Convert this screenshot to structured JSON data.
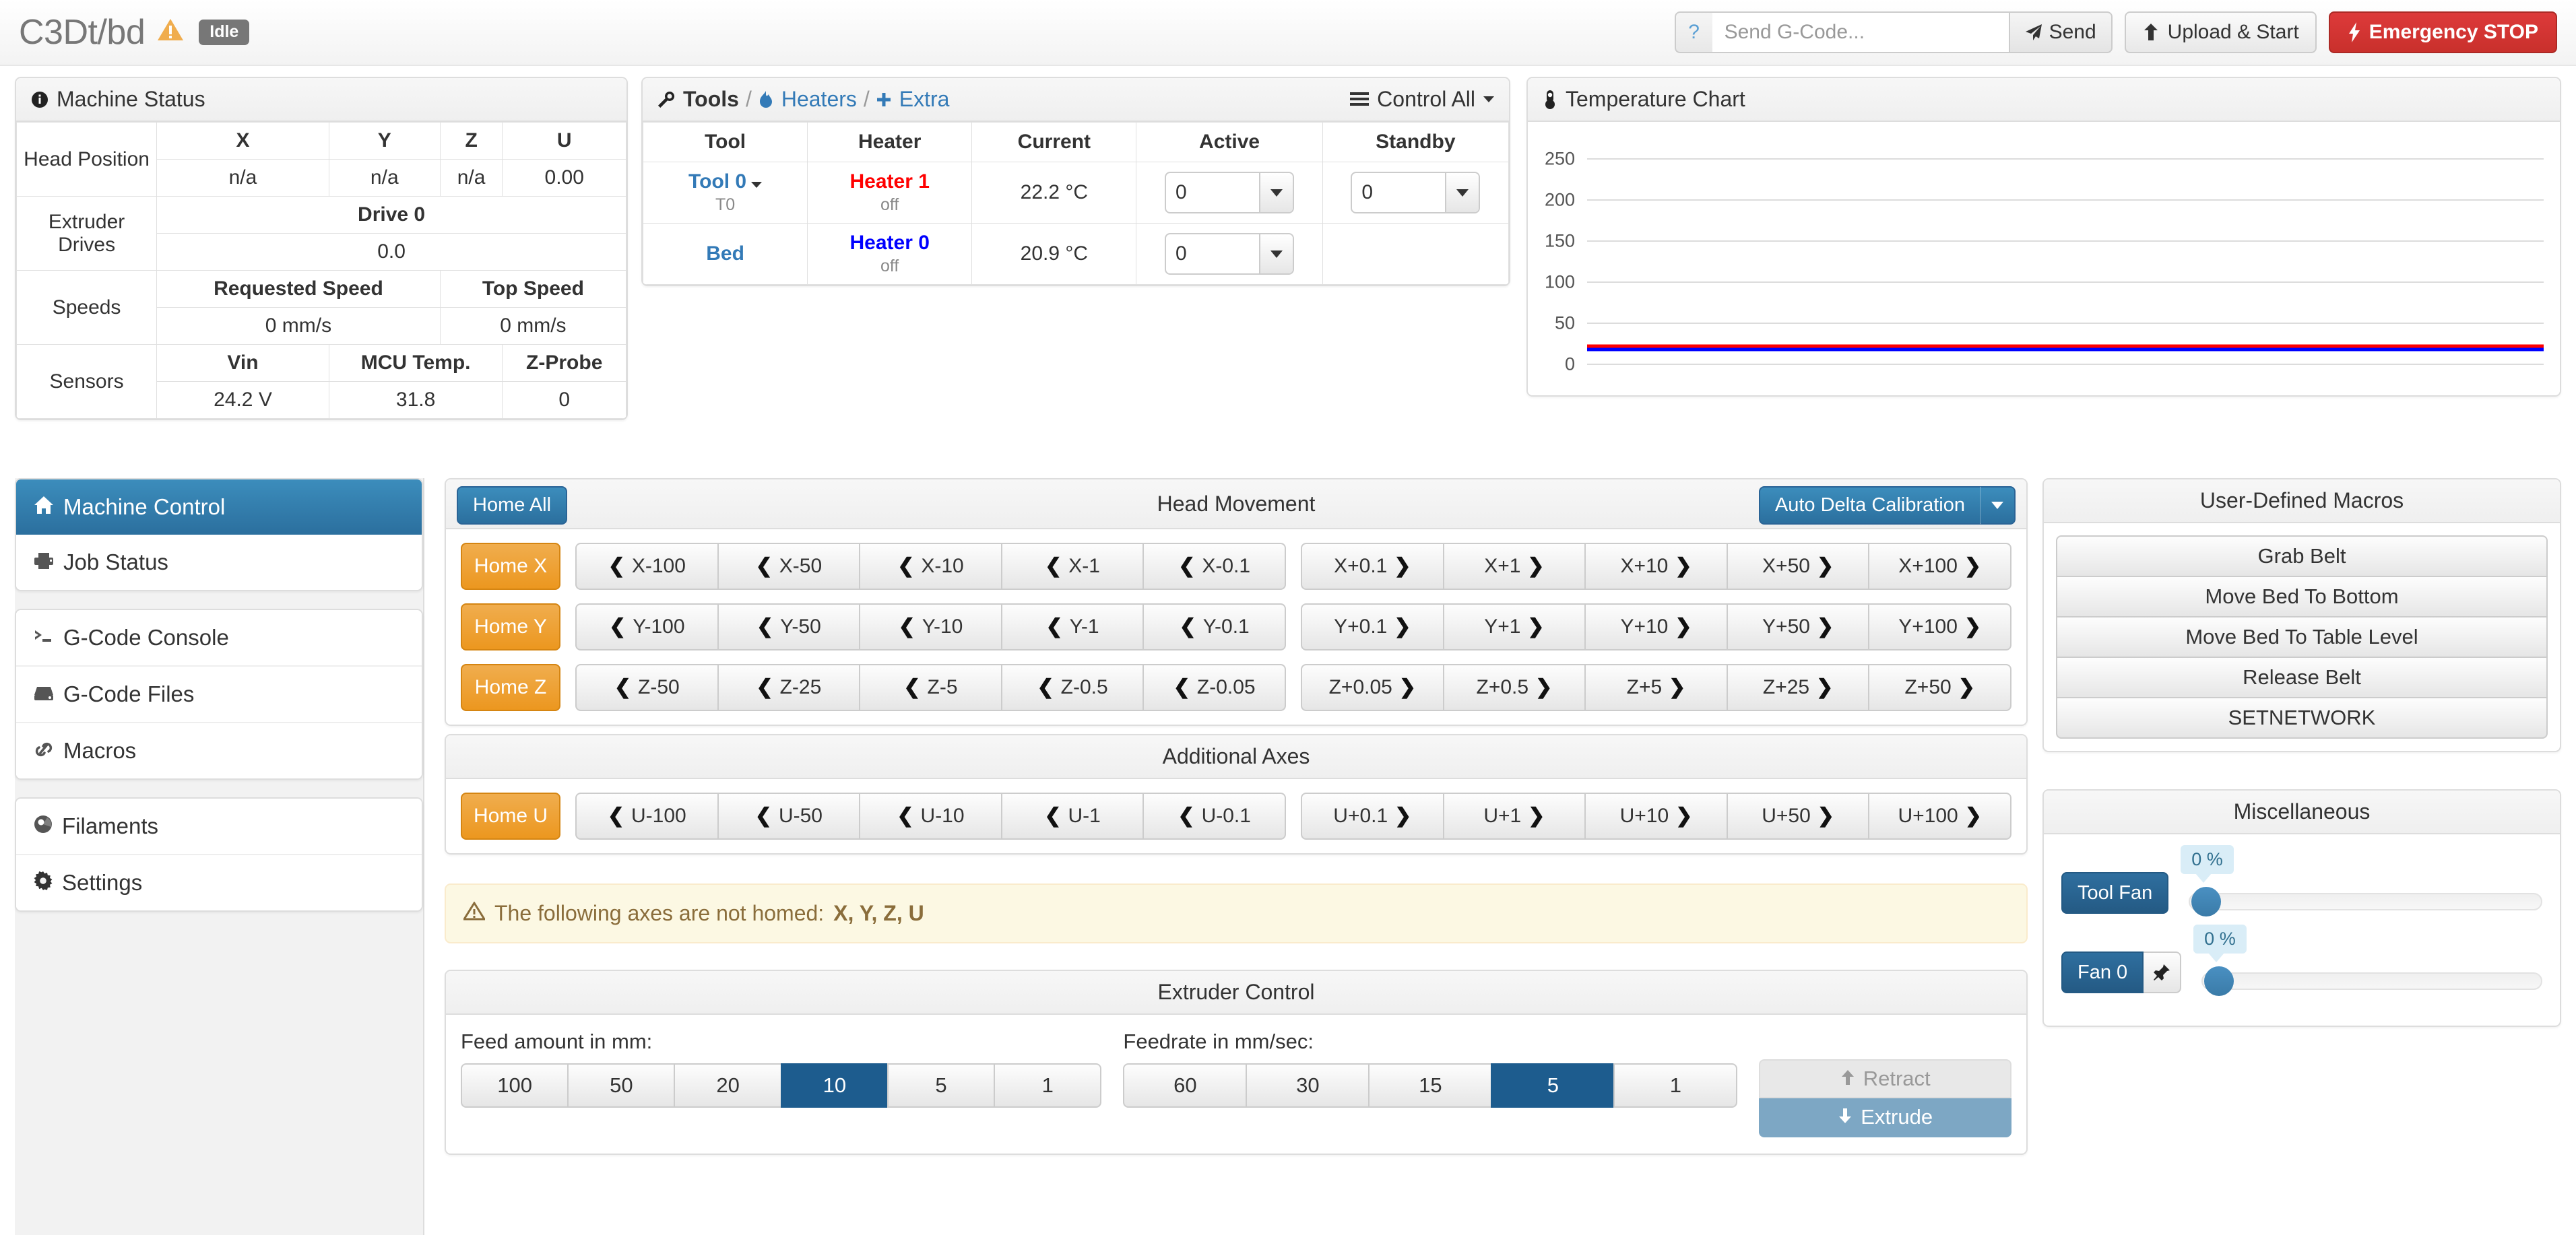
{
  "header": {
    "brand": "C3Dt/bd",
    "warning_icon": "warning-triangle-icon",
    "status": "Idle",
    "gcode_help": "?",
    "gcode_placeholder": "Send G-Code...",
    "send_label": "Send",
    "upload_label": "Upload & Start",
    "estop_label": "Emergency STOP"
  },
  "machine_status": {
    "title": "Machine Status",
    "rows": [
      {
        "label": "Head Position",
        "headers": [
          "X",
          "Y",
          "Z",
          "U"
        ],
        "values": [
          "n/a",
          "n/a",
          "n/a",
          "0.00"
        ]
      },
      {
        "label": "Extruder Drives",
        "headers": [
          "Drive 0"
        ],
        "values": [
          "0.0"
        ]
      },
      {
        "label": "Speeds",
        "headers": [
          "Requested Speed",
          "Top Speed"
        ],
        "values": [
          "0 mm/s",
          "0 mm/s"
        ]
      },
      {
        "label": "Sensors",
        "headers": [
          "Vin",
          "MCU Temp.",
          "Z-Probe"
        ],
        "values": [
          "24.2 V",
          "31.8",
          "0"
        ]
      }
    ]
  },
  "tools": {
    "tab_tools": "Tools",
    "tab_heaters": "Heaters",
    "tab_extra": "Extra",
    "sep": "/",
    "control_all": "Control All",
    "columns": [
      "Tool",
      "Heater",
      "Current",
      "Active",
      "Standby"
    ],
    "rows": [
      {
        "tool": "Tool 0",
        "tool_sub": "T0",
        "heater": "Heater 1",
        "heater_state": "off",
        "heater_color": "red",
        "current": "22.2 °C",
        "active": "0",
        "standby": "0",
        "has_standby": true
      },
      {
        "tool": "Bed",
        "tool_sub": "",
        "heater": "Heater 0",
        "heater_state": "off",
        "heater_color": "blue",
        "current": "20.9 °C",
        "active": "0",
        "standby": "",
        "has_standby": false
      }
    ]
  },
  "chart": {
    "title": "Temperature Chart"
  },
  "chart_data": {
    "type": "line",
    "title": "Temperature Chart",
    "xlabel": "",
    "ylabel": "",
    "ylim": [
      0,
      280
    ],
    "yticks": [
      0,
      50,
      100,
      150,
      200,
      250
    ],
    "grid": true,
    "legend": "none",
    "series": [
      {
        "name": "Heater 1",
        "color": "#ff0000",
        "constant_value": 22.2
      },
      {
        "name": "Heater 0",
        "color": "#0000ff",
        "constant_value": 20.9
      }
    ]
  },
  "sidebar": {
    "groups": [
      {
        "items": [
          {
            "label": "Machine Control",
            "icon": "home-icon",
            "active": true
          },
          {
            "label": "Job Status",
            "icon": "printer-icon",
            "active": false
          }
        ]
      },
      {
        "items": [
          {
            "label": "G-Code Console",
            "icon": "terminal-icon",
            "active": false
          },
          {
            "label": "G-Code Files",
            "icon": "hdd-icon",
            "active": false
          },
          {
            "label": "Macros",
            "icon": "link-icon",
            "active": false
          }
        ]
      },
      {
        "items": [
          {
            "label": "Filaments",
            "icon": "filament-icon",
            "active": false
          },
          {
            "label": "Settings",
            "icon": "gear-icon",
            "active": false
          }
        ]
      }
    ]
  },
  "head_movement": {
    "title": "Head Movement",
    "home_all": "Home All",
    "calibration": "Auto Delta Calibration",
    "rows": [
      {
        "home": "Home X",
        "neg": [
          "X-100",
          "X-50",
          "X-10",
          "X-1",
          "X-0.1"
        ],
        "pos": [
          "X+0.1",
          "X+1",
          "X+10",
          "X+50",
          "X+100"
        ]
      },
      {
        "home": "Home Y",
        "neg": [
          "Y-100",
          "Y-50",
          "Y-10",
          "Y-1",
          "Y-0.1"
        ],
        "pos": [
          "Y+0.1",
          "Y+1",
          "Y+10",
          "Y+50",
          "Y+100"
        ]
      },
      {
        "home": "Home Z",
        "neg": [
          "Z-50",
          "Z-25",
          "Z-5",
          "Z-0.5",
          "Z-0.05"
        ],
        "pos": [
          "Z+0.05",
          "Z+0.5",
          "Z+5",
          "Z+25",
          "Z+50"
        ]
      }
    ]
  },
  "additional_axes": {
    "title": "Additional Axes",
    "rows": [
      {
        "home": "Home U",
        "neg": [
          "U-100",
          "U-50",
          "U-10",
          "U-1",
          "U-0.1"
        ],
        "pos": [
          "U+0.1",
          "U+1",
          "U+10",
          "U+50",
          "U+100"
        ]
      }
    ]
  },
  "alert": {
    "icon": "warning-triangle-icon",
    "text": "The following axes are not homed: ",
    "axes": "X, Y, Z, U"
  },
  "extruder": {
    "title": "Extruder Control",
    "feed_label": "Feed amount in mm:",
    "feed_options": [
      "100",
      "50",
      "20",
      "10",
      "5",
      "1"
    ],
    "feed_selected": "10",
    "feedrate_label": "Feedrate in mm/sec:",
    "feedrate_options": [
      "60",
      "30",
      "15",
      "5",
      "1"
    ],
    "feedrate_selected": "5",
    "retract_label": "Retract",
    "extrude_label": "Extrude"
  },
  "macros": {
    "title": "User-Defined Macros",
    "items": [
      "Grab Belt",
      "Move Bed To Bottom",
      "Move Bed To Table Level",
      "Release Belt",
      "SETNETWORK"
    ]
  },
  "misc": {
    "title": "Miscellaneous",
    "fans": [
      {
        "label": "Tool Fan",
        "value": "0 %",
        "has_pin": false
      },
      {
        "label": "Fan 0",
        "value": "0 %",
        "has_pin": true,
        "pin_icon": "pushpin-icon"
      }
    ]
  },
  "colors": {
    "accent_blue": "#3c8dbc",
    "orange": "#ec971f",
    "danger_red": "#c9302c",
    "heater_hot": "#ff0000",
    "heater_bed": "#0000ff",
    "warn_bg": "#fcf8e3"
  }
}
